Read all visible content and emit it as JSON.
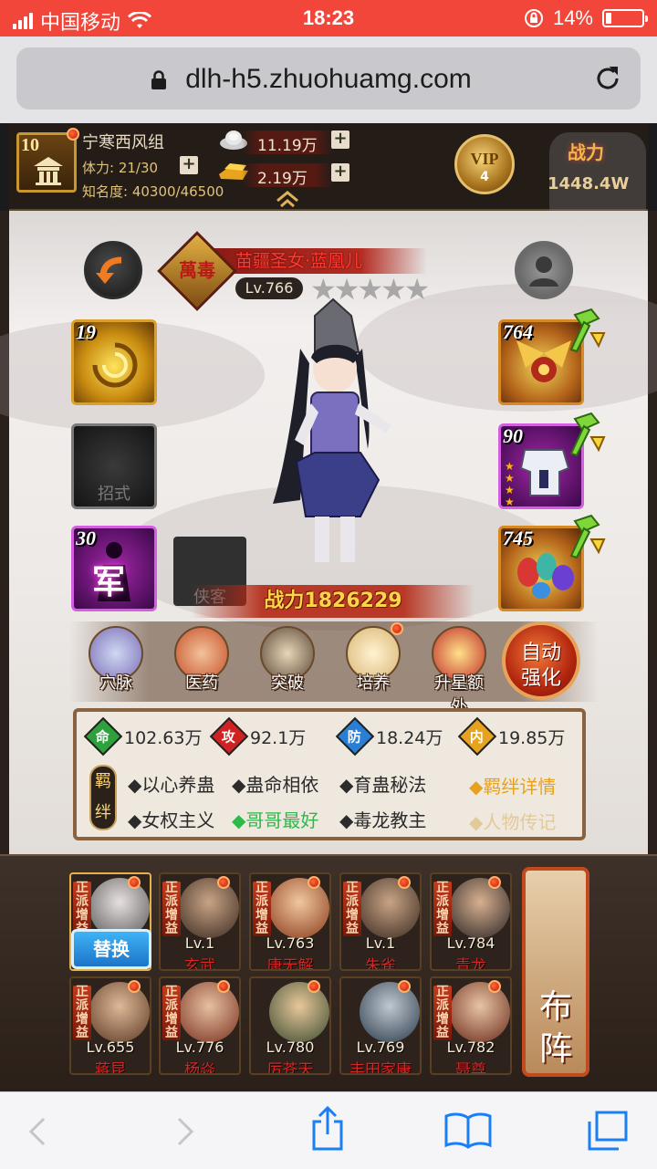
{
  "status_bar": {
    "carrier": "中国移动",
    "time": "18:23",
    "battery": "14%"
  },
  "browser": {
    "url": "dlh-h5.zhuohuamg.com"
  },
  "player": {
    "level": "10",
    "name": "宁寒西风组",
    "stamina": "体力: 21/30",
    "fame": "知名度: 40300/46500",
    "silver": "11.19万",
    "gold": "2.19万",
    "vip_label": "VIP",
    "vip_level": "4",
    "power_label": "战力",
    "power_value": "1448.4W"
  },
  "character": {
    "badge": "萬毒",
    "title": "苗疆圣女·蓝凰儿",
    "level": "Lv.766",
    "stars": "★★★★★",
    "power": "战力1826229"
  },
  "equipment": {
    "left": [
      {
        "num": "19",
        "label": ""
      },
      {
        "num": "",
        "label": "招式"
      },
      {
        "num": "30",
        "label": "军"
      }
    ],
    "extra_slot": "侠客",
    "right": [
      {
        "num": "764"
      },
      {
        "num": "90"
      },
      {
        "num": "745"
      }
    ]
  },
  "skills": [
    {
      "label": "穴脉",
      "color": "#7c6fb8"
    },
    {
      "label": "医药",
      "color": "#c8502a"
    },
    {
      "label": "突破",
      "color": "#5b4a3a"
    },
    {
      "label": "培养",
      "color": "#d9b573"
    },
    {
      "label": "升星额外",
      "color": "#c1302a"
    }
  ],
  "auto_button": {
    "line1": "自动",
    "line2": "强化"
  },
  "stats": [
    {
      "icon": "命",
      "color": "#2ea03c",
      "value": "102.63万"
    },
    {
      "icon": "攻",
      "color": "#d02222",
      "value": "92.1万"
    },
    {
      "icon": "防",
      "color": "#2a7fd4",
      "value": "18.24万"
    },
    {
      "icon": "内",
      "color": "#e5a31e",
      "value": "19.85万"
    }
  ],
  "bonds": {
    "tag": "羁绊",
    "row1": [
      "◆以心养蛊",
      "◆蛊命相依",
      "◆育蛊秘法"
    ],
    "row2": [
      "◆女权主义",
      "◆哥哥最好",
      "◆毒龙教主"
    ],
    "link_details": "◆羁绊详情",
    "link_bio": "◆人物传记"
  },
  "formation": {
    "tag": "正派增益",
    "swap": "替换",
    "row1": [
      {
        "lv": "",
        "name": ""
      },
      {
        "lv": "Lv.1",
        "name": "玄武"
      },
      {
        "lv": "Lv.763",
        "name": "唐无解"
      },
      {
        "lv": "Lv.1",
        "name": "朱雀"
      },
      {
        "lv": "Lv.784",
        "name": "青龙"
      }
    ],
    "row2": [
      {
        "lv": "Lv.655",
        "name": "蒋昆"
      },
      {
        "lv": "Lv.776",
        "name": "杨焱"
      },
      {
        "lv": "Lv.780",
        "name": "厉苍天"
      },
      {
        "lv": "Lv.769",
        "name": "丰田家康"
      },
      {
        "lv": "Lv.782",
        "name": "聂尊"
      }
    ],
    "buzhen": [
      "布",
      "阵"
    ]
  }
}
